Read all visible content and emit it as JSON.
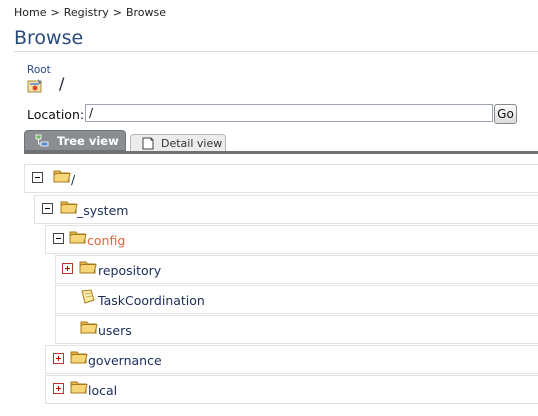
{
  "breadcrumb": {
    "items": [
      "Home",
      "Registry",
      "Browse"
    ],
    "separator": ">"
  },
  "page": {
    "title": "Browse"
  },
  "root": {
    "link_label": "Root",
    "path": "/",
    "icon": "registry-root-icon"
  },
  "location": {
    "label": "Location:",
    "value": "/",
    "go_label": "Go"
  },
  "tabs": [
    {
      "label": "Tree view",
      "icon": "tree-view-icon",
      "active": true
    },
    {
      "label": "Detail view",
      "icon": "detail-view-icon",
      "active": false
    }
  ],
  "tree": {
    "nodes": [
      {
        "label": "/",
        "type": "collection",
        "expander": "minus"
      },
      {
        "label": "_system",
        "type": "collection",
        "expander": "minus"
      },
      {
        "label": "config",
        "type": "collection",
        "expander": "minus",
        "highlighted": true
      },
      {
        "label": "repository",
        "type": "collection",
        "expander": "plus"
      },
      {
        "label": "TaskCoordination",
        "type": "resource",
        "expander": "none"
      },
      {
        "label": "users",
        "type": "collection",
        "expander": "none"
      },
      {
        "label": "governance",
        "type": "collection",
        "expander": "plus"
      },
      {
        "label": "local",
        "type": "collection",
        "expander": "plus"
      }
    ]
  },
  "colors": {
    "title": "#2a4a7a",
    "link": "#1d2d5a",
    "highlight": "#e0663a",
    "folder": "#e8b84a",
    "tab_active": "#8a8e93"
  }
}
